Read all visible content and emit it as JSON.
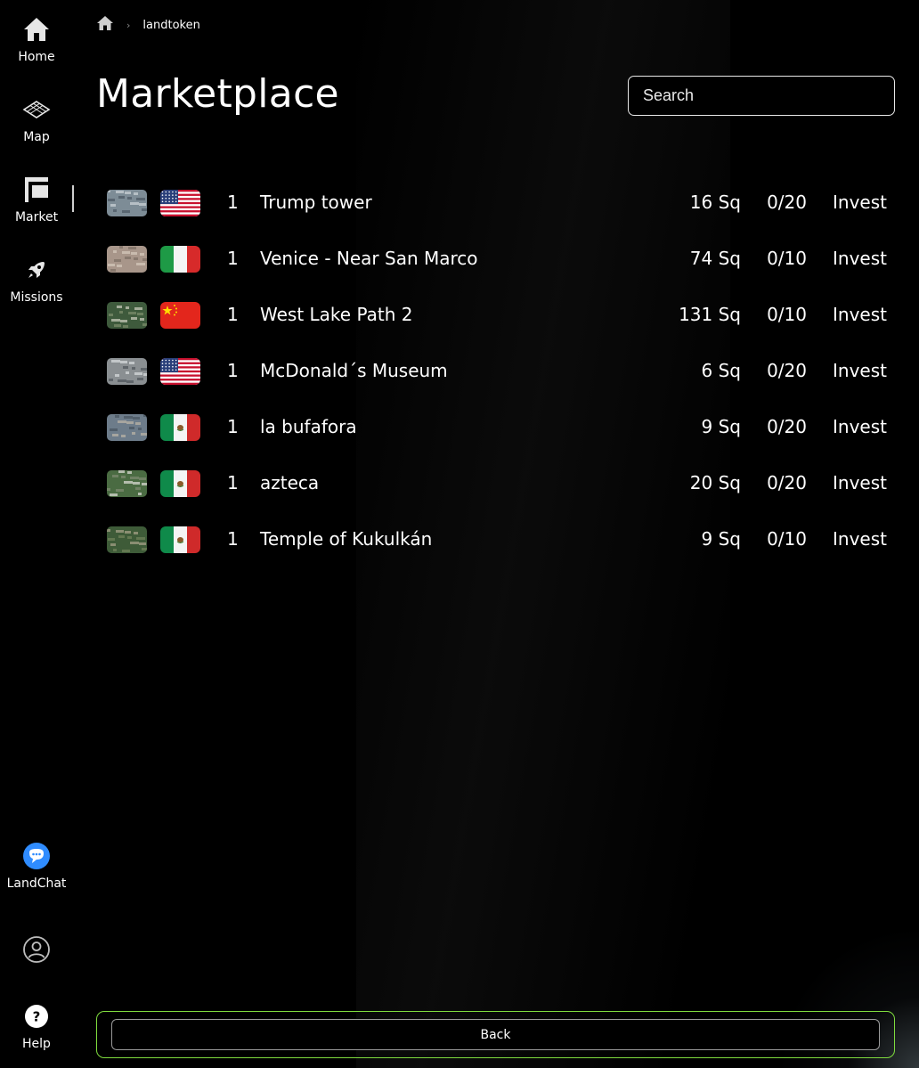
{
  "nav": {
    "home": "Home",
    "map": "Map",
    "market": "Market",
    "missions": "Missions",
    "landchat": "LandChat",
    "help": "Help"
  },
  "breadcrumb": {
    "current": "landtoken"
  },
  "page": {
    "title": "Marketplace"
  },
  "search": {
    "placeholder": "Search"
  },
  "listings": [
    {
      "qty": "1",
      "name": "Trump tower",
      "size": "16 Sq",
      "slots": "0/20",
      "action": "Invest",
      "flag": "us"
    },
    {
      "qty": "1",
      "name": "Venice - Near San Marco",
      "size": "74 Sq",
      "slots": "0/10",
      "action": "Invest",
      "flag": "it"
    },
    {
      "qty": "1",
      "name": "West Lake Path 2",
      "size": "131 Sq",
      "slots": "0/10",
      "action": "Invest",
      "flag": "cn"
    },
    {
      "qty": "1",
      "name": "McDonald´s Museum",
      "size": "6 Sq",
      "slots": "0/20",
      "action": "Invest",
      "flag": "us"
    },
    {
      "qty": "1",
      "name": "la bufafora",
      "size": "9 Sq",
      "slots": "0/20",
      "action": "Invest",
      "flag": "mx"
    },
    {
      "qty": "1",
      "name": "azteca",
      "size": "20 Sq",
      "slots": "0/20",
      "action": "Invest",
      "flag": "mx"
    },
    {
      "qty": "1",
      "name": "Temple of Kukulkán",
      "size": "9 Sq",
      "slots": "0/10",
      "action": "Invest",
      "flag": "mx"
    }
  ],
  "footer": {
    "back_label": "Back"
  },
  "colors": {
    "accent_border": "#7fdc3e",
    "chat_icon": "#2f8cff",
    "background": "#000000"
  }
}
